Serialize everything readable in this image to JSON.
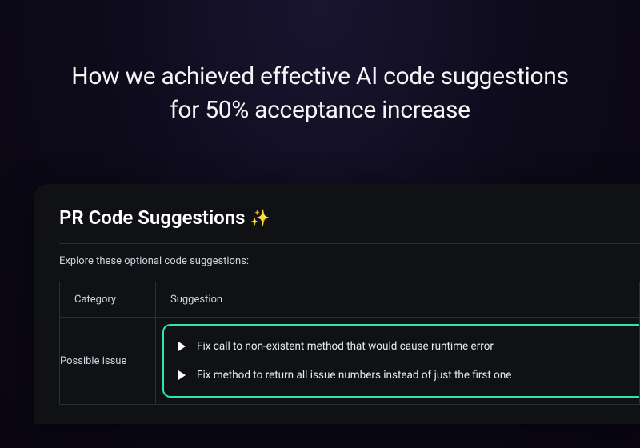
{
  "hero": {
    "title_line1": "How we achieved effective AI code suggestions",
    "title_line2": "for 50% acceptance increase"
  },
  "panel": {
    "title": "PR Code Suggestions",
    "sparkle": "✨",
    "subtitle": "Explore these optional code suggestions:",
    "columns": {
      "category": "Category",
      "suggestion": "Suggestion"
    },
    "rows": [
      {
        "category": "Possible issue",
        "suggestions": [
          "Fix call to non-existent method that would cause runtime error",
          "Fix method to return all issue numbers instead of just the first one"
        ]
      }
    ]
  }
}
